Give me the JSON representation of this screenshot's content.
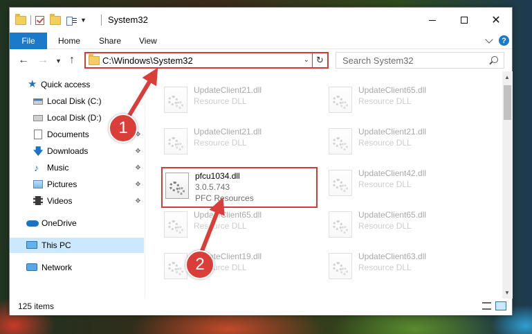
{
  "window": {
    "title": "System32"
  },
  "ribbon": {
    "tabs": [
      "File",
      "Home",
      "Share",
      "View"
    ]
  },
  "navigation": {
    "address_path": "C:\\Windows\\System32",
    "search_placeholder": "Search System32"
  },
  "sidebar": {
    "items": [
      {
        "label": "Quick access",
        "icon": "star-icon"
      },
      {
        "label": "Local Disk (C:)",
        "icon": "drive-icon"
      },
      {
        "label": "Local Disk (D:)",
        "icon": "drive-icon"
      },
      {
        "label": "Documents",
        "icon": "document-icon",
        "pinned": true
      },
      {
        "label": "Downloads",
        "icon": "download-icon",
        "pinned": true
      },
      {
        "label": "Music",
        "icon": "music-icon",
        "pinned": true
      },
      {
        "label": "Pictures",
        "icon": "pictures-icon",
        "pinned": true
      },
      {
        "label": "Videos",
        "icon": "videos-icon",
        "pinned": true
      },
      {
        "label": "OneDrive",
        "icon": "cloud-icon"
      },
      {
        "label": "This PC",
        "icon": "computer-icon",
        "selected": true
      },
      {
        "label": "Network",
        "icon": "network-icon"
      }
    ]
  },
  "files": {
    "left_column": [
      {
        "name": "UpdateClient21.dll",
        "type": "Resource DLL"
      },
      {
        "name": "UpdateClient21.dll",
        "type": "Resource DLL"
      },
      {
        "name": "pfcu1034.dll",
        "version": "3.0.5.743",
        "type": "PFC Resources",
        "highlighted": true
      },
      {
        "name": "UpdateClient65.dll",
        "type": "Resource DLL"
      },
      {
        "name": "UpdateClient19.dll",
        "type": "Resource DLL"
      }
    ],
    "right_column": [
      {
        "name": "UpdateClient65.dll",
        "type": "Resource DLL"
      },
      {
        "name": "UpdateClient21.dll",
        "type": "Resource DLL"
      },
      {
        "name": "UpdateClient42.dll",
        "type": "Resource DLL"
      },
      {
        "name": "UpdateClient65.dll",
        "type": "Resource DLL"
      },
      {
        "name": "UpdateClient63.dll",
        "type": "Resource DLL"
      }
    ]
  },
  "status": {
    "item_count": "125 items"
  },
  "annotations": {
    "step1": "1",
    "step2": "2",
    "color": "#d93e39"
  }
}
